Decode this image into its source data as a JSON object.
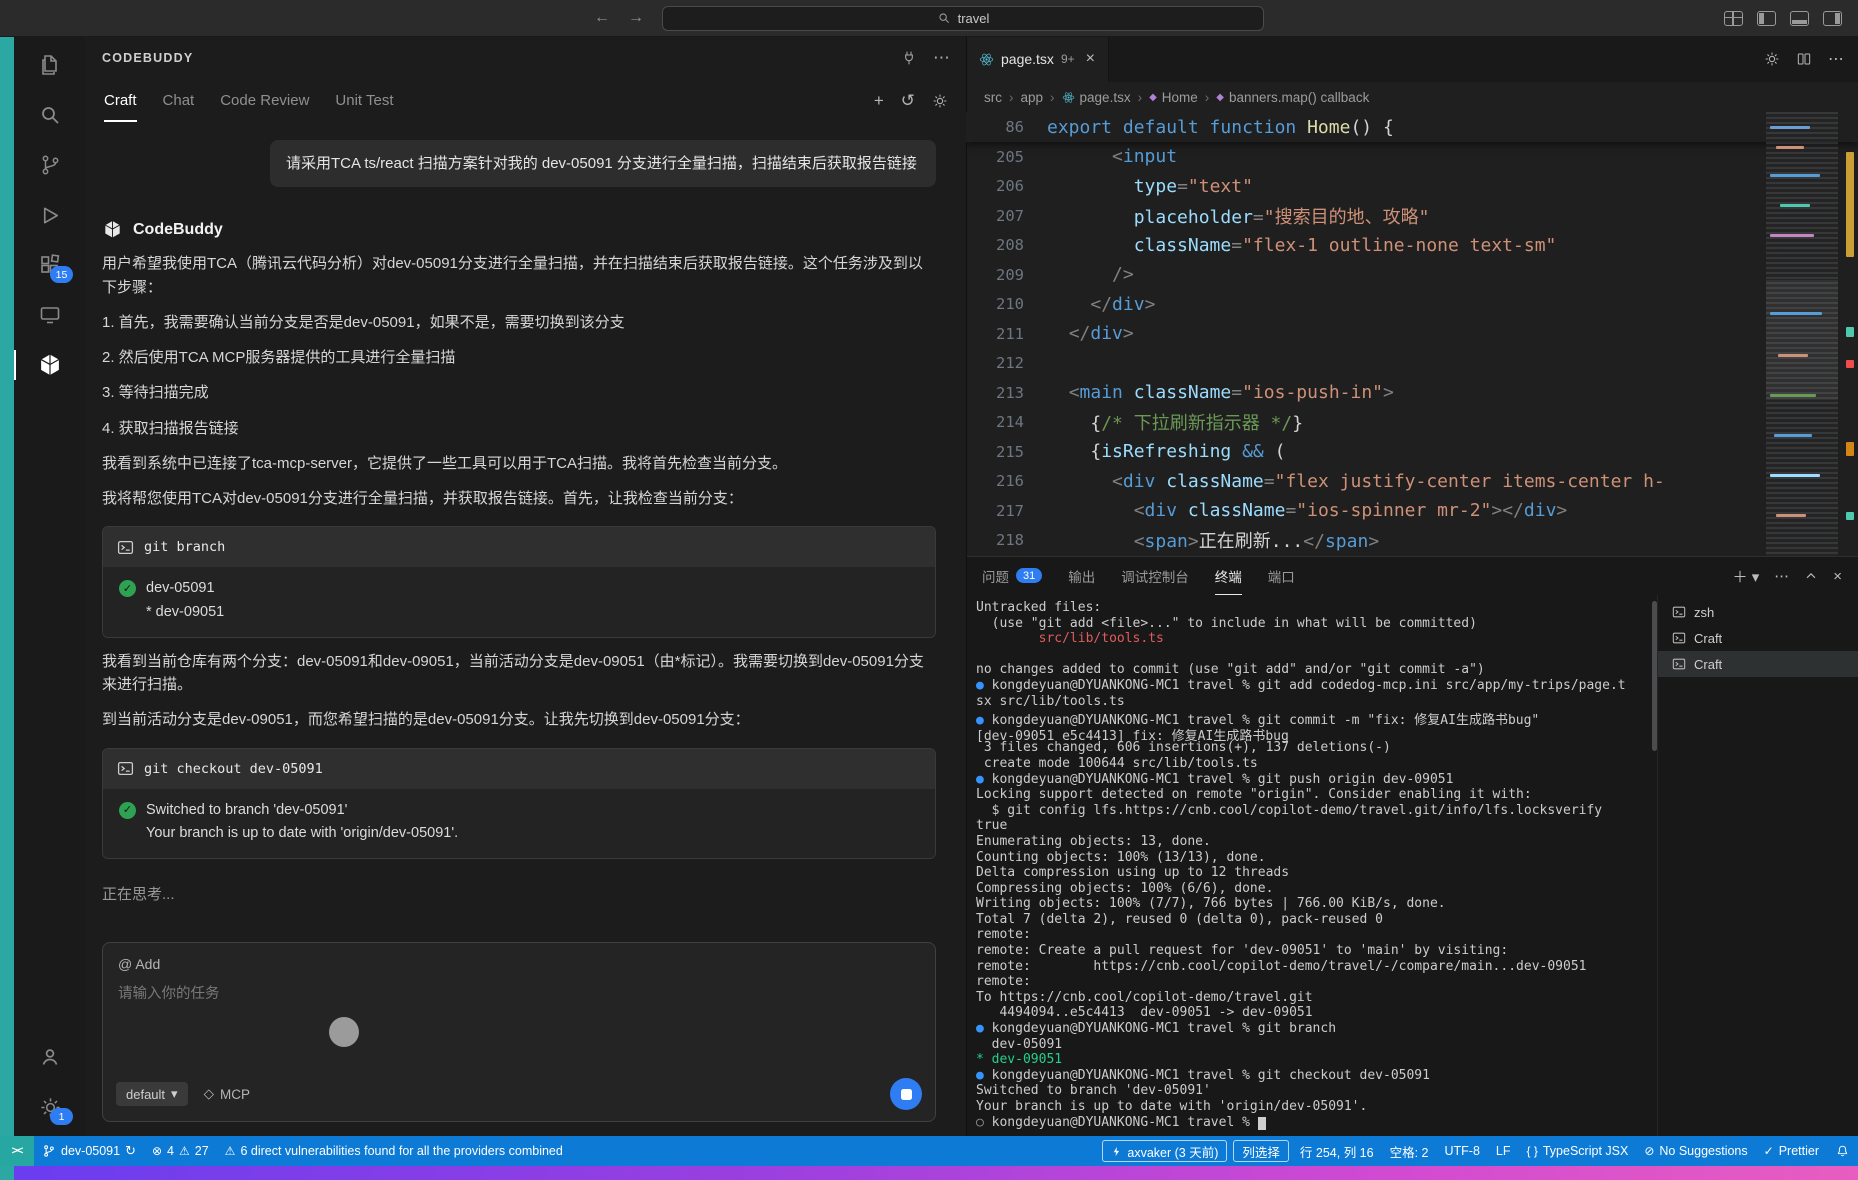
{
  "titlebar": {
    "search_value": "travel"
  },
  "activity_bar": {
    "extensions_badge": "15",
    "settings_badge": "1"
  },
  "codebuddy": {
    "title": "CODEBUDDY",
    "tabs": [
      "Craft",
      "Chat",
      "Code Review",
      "Unit Test"
    ],
    "active_tab": "Craft",
    "user_message": "请采用TCA ts/react 扫描方案针对我的 dev-05091 分支进行全量扫描，扫描结束后获取报告链接",
    "assistant_name": "CodeBuddy",
    "intro_paragraphs": [
      "用户希望我使用TCA（腾讯云代码分析）对dev-05091分支进行全量扫描，并在扫描结束后获取报告链接。这个任务涉及到以下步骤：",
      "1. 首先，我需要确认当前分支是否是dev-05091，如果不是，需要切换到该分支",
      "2. 然后使用TCA MCP服务器提供的工具进行全量扫描",
      "3. 等待扫描完成",
      "4. 获取扫描报告链接",
      "我看到系统中已连接了tca-mcp-server，它提供了一些工具可以用于TCA扫描。我将首先检查当前分支。",
      "我将帮您使用TCA对dev-05091分支进行全量扫描，并获取报告链接。首先，让我检查当前分支："
    ],
    "blocks": [
      {
        "command": "git branch",
        "output": [
          "dev-05091",
          "* dev-09051"
        ]
      },
      {
        "command": "git checkout dev-05091",
        "output": [
          "Switched to branch 'dev-05091'",
          "Your branch is up to date with 'origin/dev-05091'."
        ]
      }
    ],
    "mid_paragraphs": [
      "我看到当前仓库有两个分支：dev-05091和dev-09051，当前活动分支是dev-09051（由*标记）。我需要切换到dev-05091分支来进行扫描。",
      "到当前活动分支是dev-09051，而您希望扫描的是dev-05091分支。让我先切换到dev-05091分支："
    ],
    "thinking": "正在思考...",
    "composer": {
      "add_label": "@ Add",
      "placeholder": "请输入你的任务",
      "model": "default",
      "mcp_label": "MCP"
    }
  },
  "editor": {
    "tab": {
      "title": "page.tsx",
      "badge": "9+"
    },
    "breadcrumbs": [
      {
        "label": "src"
      },
      {
        "label": "app"
      },
      {
        "label": "page.tsx",
        "icon": "react"
      },
      {
        "label": "Home",
        "icon": "symbol"
      },
      {
        "label": "banners.map() callback",
        "icon": "symbol"
      }
    ],
    "sticky": {
      "n": "86",
      "seg": [
        [
          "export default function ",
          "k"
        ],
        [
          "Home",
          "f"
        ],
        [
          "() {",
          "x"
        ]
      ]
    },
    "lines": [
      {
        "n": "205",
        "seg": [
          [
            "      ",
            "x"
          ],
          [
            "<",
            "p"
          ],
          [
            "input",
            "t"
          ]
        ]
      },
      {
        "n": "206",
        "seg": [
          [
            "        ",
            "x"
          ],
          [
            "type",
            "a"
          ],
          [
            "=",
            "p"
          ],
          [
            "\"text\"",
            "s"
          ]
        ]
      },
      {
        "n": "207",
        "seg": [
          [
            "        ",
            "x"
          ],
          [
            "placeholder",
            "a"
          ],
          [
            "=",
            "p"
          ],
          [
            "\"搜索目的地、攻略\"",
            "s"
          ]
        ]
      },
      {
        "n": "208",
        "seg": [
          [
            "        ",
            "x"
          ],
          [
            "className",
            "a"
          ],
          [
            "=",
            "p"
          ],
          [
            "\"flex-1 outline-none text-sm\"",
            "s"
          ]
        ]
      },
      {
        "n": "209",
        "seg": [
          [
            "      ",
            "x"
          ],
          [
            "/>",
            "p"
          ]
        ]
      },
      {
        "n": "210",
        "seg": [
          [
            "    ",
            "x"
          ],
          [
            "</",
            "p"
          ],
          [
            "div",
            "t"
          ],
          [
            ">",
            "p"
          ]
        ]
      },
      {
        "n": "211",
        "seg": [
          [
            "  ",
            "x"
          ],
          [
            "</",
            "p"
          ],
          [
            "div",
            "t"
          ],
          [
            ">",
            "p"
          ]
        ]
      },
      {
        "n": "212",
        "seg": [
          [
            "",
            "x"
          ]
        ]
      },
      {
        "n": "213",
        "seg": [
          [
            "  ",
            "x"
          ],
          [
            "<",
            "p"
          ],
          [
            "main",
            "t"
          ],
          [
            " ",
            "x"
          ],
          [
            "className",
            "a"
          ],
          [
            "=",
            "p"
          ],
          [
            "\"ios-push-in\"",
            "s"
          ],
          [
            ">",
            "p"
          ]
        ]
      },
      {
        "n": "214",
        "seg": [
          [
            "    ",
            "x"
          ],
          [
            "{",
            "x"
          ],
          [
            "/* 下拉刷新指示器 */",
            "c"
          ],
          [
            "}",
            "x"
          ]
        ]
      },
      {
        "n": "215",
        "seg": [
          [
            "    ",
            "x"
          ],
          [
            "{",
            "x"
          ],
          [
            "isRefreshing",
            "a"
          ],
          [
            " ",
            "x"
          ],
          [
            "&&",
            "k"
          ],
          [
            " (",
            "x"
          ]
        ]
      },
      {
        "n": "216",
        "seg": [
          [
            "      ",
            "x"
          ],
          [
            "<",
            "p"
          ],
          [
            "div",
            "t"
          ],
          [
            " ",
            "x"
          ],
          [
            "className",
            "a"
          ],
          [
            "=",
            "p"
          ],
          [
            "\"flex justify-center items-center h-",
            "s"
          ]
        ]
      },
      {
        "n": "217",
        "seg": [
          [
            "        ",
            "x"
          ],
          [
            "<",
            "p"
          ],
          [
            "div",
            "t"
          ],
          [
            " ",
            "x"
          ],
          [
            "className",
            "a"
          ],
          [
            "=",
            "p"
          ],
          [
            "\"ios-spinner mr-2\"",
            "s"
          ],
          [
            ">",
            "p"
          ],
          [
            "</",
            "p"
          ],
          [
            "div",
            "t"
          ],
          [
            ">",
            "p"
          ]
        ]
      },
      {
        "n": "218",
        "seg": [
          [
            "        ",
            "x"
          ],
          [
            "<",
            "p"
          ],
          [
            "span",
            "t"
          ],
          [
            ">",
            "p"
          ],
          [
            "正在刷新...",
            "x"
          ],
          [
            "</",
            "p"
          ],
          [
            "span",
            "t"
          ],
          [
            ">",
            "p"
          ]
        ]
      }
    ]
  },
  "panel": {
    "tabs": [
      {
        "label": "问题",
        "key": "problems",
        "badge": "31"
      },
      {
        "label": "输出",
        "key": "output"
      },
      {
        "label": "调试控制台",
        "key": "debug-console"
      },
      {
        "label": "终端",
        "key": "terminal",
        "active": true
      },
      {
        "label": "端口",
        "key": "ports"
      }
    ],
    "terminal_lines": [
      [
        [
          "Untracked files:",
          ""
        ]
      ],
      [
        [
          "  (use \"git add <file>...\" to include in what will be committed)",
          ""
        ]
      ],
      [
        [
          "        ",
          ""
        ],
        [
          "src/lib/tools.ts",
          "r"
        ]
      ],
      [
        [
          "",
          ""
        ]
      ],
      [
        [
          "no changes added to commit (use \"git add\" and/or \"git commit -a\")",
          ""
        ]
      ],
      [
        [
          "● ",
          "b"
        ],
        [
          "kongdeyuan@DYUANKONG-MC1 travel % git add codedog-mcp.ini src/app/my-trips/page.t",
          ""
        ]
      ],
      [
        [
          "sx src/lib/tools.ts",
          ""
        ]
      ],
      [
        [
          "● ",
          "b"
        ],
        [
          "kongdeyuan@DYUANKONG-MC1 travel % git commit -m \"fix: 修复AI生成路书bug\"",
          ""
        ]
      ],
      [
        [
          "[dev-09051 e5c4413] fix: 修复AI生成路书bug",
          ""
        ]
      ],
      [
        [
          " 3 files changed, 606 insertions(+), 137 deletions(-)",
          ""
        ]
      ],
      [
        [
          " create mode 100644 src/lib/tools.ts",
          ""
        ]
      ],
      [
        [
          "● ",
          "b"
        ],
        [
          "kongdeyuan@DYUANKONG-MC1 travel % git push origin dev-09051",
          ""
        ]
      ],
      [
        [
          "Locking support detected on remote \"origin\". Consider enabling it with:",
          ""
        ]
      ],
      [
        [
          "  $ git config lfs.https://cnb.cool/copilot-demo/travel.git/info/lfs.locksverify",
          ""
        ]
      ],
      [
        [
          "true",
          ""
        ]
      ],
      [
        [
          "Enumerating objects: 13, done.",
          ""
        ]
      ],
      [
        [
          "Counting objects: 100% (13/13), done.",
          ""
        ]
      ],
      [
        [
          "Delta compression using up to 12 threads",
          ""
        ]
      ],
      [
        [
          "Compressing objects: 100% (6/6), done.",
          ""
        ]
      ],
      [
        [
          "Writing objects: 100% (7/7), 766 bytes | 766.00 KiB/s, done.",
          ""
        ]
      ],
      [
        [
          "Total 7 (delta 2), reused 0 (delta 0), pack-reused 0",
          ""
        ]
      ],
      [
        [
          "remote:",
          ""
        ]
      ],
      [
        [
          "remote: Create a pull request for 'dev-09051' to 'main' by visiting:",
          ""
        ]
      ],
      [
        [
          "remote:        https://cnb.cool/copilot-demo/travel/-/compare/main...dev-09051",
          ""
        ]
      ],
      [
        [
          "remote:",
          ""
        ]
      ],
      [
        [
          "To https://cnb.cool/copilot-demo/travel.git",
          ""
        ]
      ],
      [
        [
          "   4494094..e5c4413  dev-09051 -> dev-09051",
          ""
        ]
      ],
      [
        [
          "● ",
          "b"
        ],
        [
          "kongdeyuan@DYUANKONG-MC1 travel % git branch",
          ""
        ]
      ],
      [
        [
          "  dev-05091",
          ""
        ]
      ],
      [
        [
          "* dev-09051",
          "g"
        ]
      ],
      [
        [
          "● ",
          "b"
        ],
        [
          "kongdeyuan@DYUANKONG-MC1 travel % git checkout dev-05091",
          ""
        ]
      ],
      [
        [
          "Switched to branch 'dev-05091'",
          ""
        ]
      ],
      [
        [
          "Your branch is up to date with 'origin/dev-05091'.",
          ""
        ]
      ],
      [
        [
          "○ ",
          "dim"
        ],
        [
          "kongdeyuan@DYUANKONG-MC1 travel % ",
          ""
        ],
        [
          " ",
          "cur"
        ]
      ]
    ],
    "terminal_list": [
      {
        "label": "zsh"
      },
      {
        "label": "Craft"
      },
      {
        "label": "Craft",
        "active": true
      }
    ]
  },
  "statusbar": {
    "remote": "><",
    "branch": "dev-05091",
    "errors": "4",
    "warnings": "27",
    "security": "6 direct vulnerabilities found for all the providers combined",
    "blame": "axvaker (3 天前)",
    "selection_mode": "列选择",
    "position": "行 254, 列 16",
    "indent": "空格: 2",
    "encoding": "UTF-8",
    "eol": "LF",
    "language": "TypeScript JSX",
    "suggestions": "No Suggestions",
    "formatter": "Prettier"
  }
}
